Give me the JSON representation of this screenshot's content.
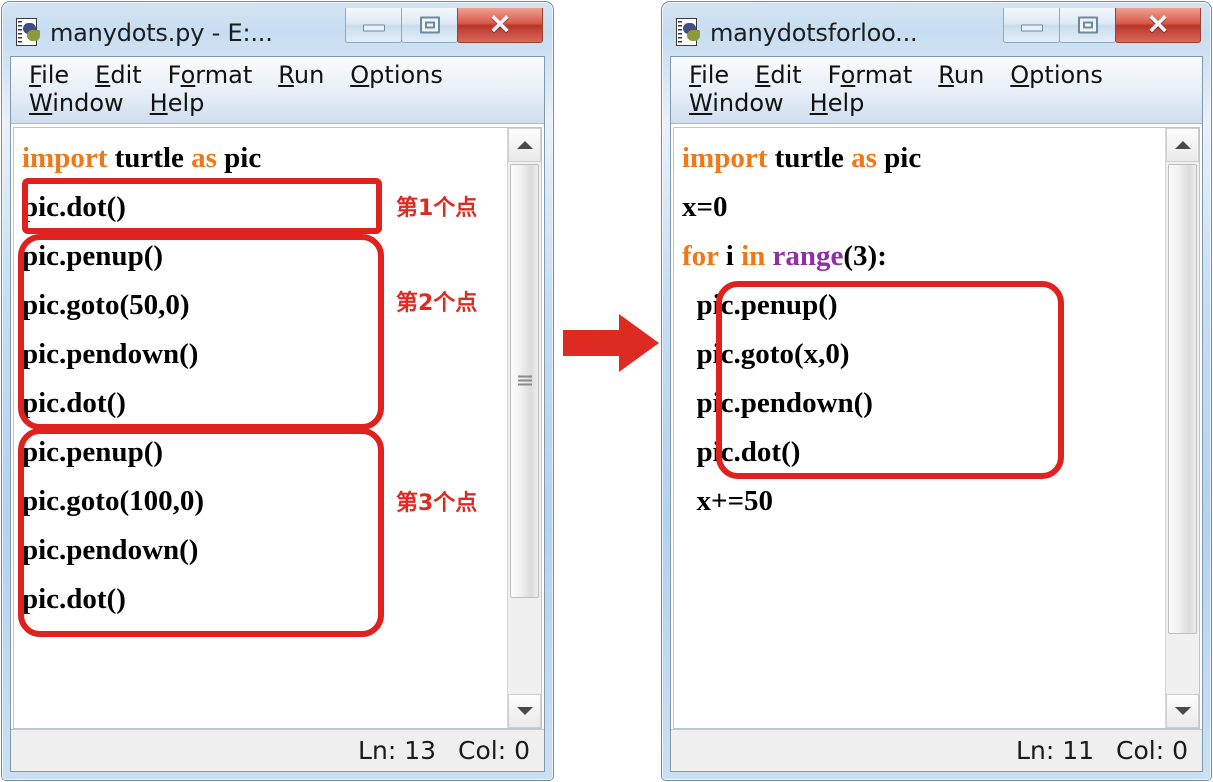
{
  "windows": [
    {
      "id": "left",
      "title": "manydots.py - E:...",
      "icon": "python-file-icon",
      "caption_buttons": [
        {
          "name": "minimize-button",
          "label": ""
        },
        {
          "name": "maximize-button",
          "label": ""
        },
        {
          "name": "close-button",
          "label": "✕"
        }
      ],
      "menus_row1": [
        {
          "name": "menu-file",
          "pre": "",
          "mn": "F",
          "post": "ile"
        },
        {
          "name": "menu-edit",
          "pre": "",
          "mn": "E",
          "post": "dit"
        },
        {
          "name": "menu-format",
          "pre": "F",
          "mn": "o",
          "post": "rmat"
        },
        {
          "name": "menu-run",
          "pre": "",
          "mn": "R",
          "post": "un"
        },
        {
          "name": "menu-options",
          "pre": "",
          "mn": "O",
          "post": "ptions"
        }
      ],
      "menus_row2": [
        {
          "name": "menu-window",
          "pre": "",
          "mn": "W",
          "post": "indow"
        },
        {
          "name": "menu-help",
          "pre": "",
          "mn": "H",
          "post": "elp"
        }
      ],
      "code_lines": [
        [
          {
            "t": "import",
            "c": "kw"
          },
          {
            "t": " turtle ",
            "c": ""
          },
          {
            "t": "as",
            "c": "kw"
          },
          {
            "t": " pic",
            "c": ""
          }
        ],
        [
          {
            "t": "pic.dot()",
            "c": ""
          }
        ],
        [
          {
            "t": "pic.penup()",
            "c": ""
          }
        ],
        [
          {
            "t": "pic.goto(50,0)",
            "c": ""
          }
        ],
        [
          {
            "t": "pic.pendown()",
            "c": ""
          }
        ],
        [
          {
            "t": "pic.dot()",
            "c": ""
          }
        ],
        [
          {
            "t": "pic.penup()",
            "c": ""
          }
        ],
        [
          {
            "t": "pic.goto(100,0)",
            "c": ""
          }
        ],
        [
          {
            "t": "pic.pendown()",
            "c": ""
          }
        ],
        [
          {
            "t": "pic.dot()",
            "c": ""
          }
        ]
      ],
      "annotations": [
        {
          "name": "annotation-label-point-1",
          "text": "第1个点"
        },
        {
          "name": "annotation-label-point-2",
          "text": "第2个点"
        },
        {
          "name": "annotation-label-point-3",
          "text": "第3个点"
        }
      ],
      "status": {
        "line": "Ln: 13",
        "col": "Col: 0"
      }
    },
    {
      "id": "right",
      "title": "manydotsforloo...",
      "icon": "python-file-icon",
      "caption_buttons": [
        {
          "name": "minimize-button",
          "label": ""
        },
        {
          "name": "maximize-button",
          "label": ""
        },
        {
          "name": "close-button",
          "label": "✕"
        }
      ],
      "menus_row1": [
        {
          "name": "menu-file",
          "pre": "",
          "mn": "F",
          "post": "ile"
        },
        {
          "name": "menu-edit",
          "pre": "",
          "mn": "E",
          "post": "dit"
        },
        {
          "name": "menu-format",
          "pre": "F",
          "mn": "o",
          "post": "rmat"
        },
        {
          "name": "menu-run",
          "pre": "",
          "mn": "R",
          "post": "un"
        },
        {
          "name": "menu-options",
          "pre": "",
          "mn": "O",
          "post": "ptions"
        }
      ],
      "menus_row2": [
        {
          "name": "menu-window",
          "pre": "",
          "mn": "W",
          "post": "indow"
        },
        {
          "name": "menu-help",
          "pre": "",
          "mn": "H",
          "post": "elp"
        }
      ],
      "code_lines": [
        [
          {
            "t": "import",
            "c": "kw"
          },
          {
            "t": " turtle ",
            "c": ""
          },
          {
            "t": "as",
            "c": "kw"
          },
          {
            "t": " pic",
            "c": ""
          }
        ],
        [
          {
            "t": "x=0",
            "c": ""
          }
        ],
        [
          {
            "t": "for",
            "c": "kw"
          },
          {
            "t": " i ",
            "c": ""
          },
          {
            "t": "in",
            "c": "kw"
          },
          {
            "t": " ",
            "c": ""
          },
          {
            "t": "range",
            "c": "bi"
          },
          {
            "t": "(3):",
            "c": ""
          }
        ],
        [
          {
            "t": "  pic.penup()",
            "c": ""
          }
        ],
        [
          {
            "t": "  pic.goto(x,0)",
            "c": ""
          }
        ],
        [
          {
            "t": "  pic.pendown()",
            "c": ""
          }
        ],
        [
          {
            "t": "  pic.dot()",
            "c": ""
          }
        ],
        [
          {
            "t": "  x+=50",
            "c": ""
          }
        ]
      ],
      "annotations": [],
      "status": {
        "line": "Ln: 11",
        "col": "Col: 0"
      }
    }
  ],
  "arrow": {
    "name": "flow-arrow-right",
    "color": "#dd2b22"
  },
  "colors": {
    "keyword": "#f07818",
    "builtin": "#8f2fa8",
    "annotation": "#dd2b22",
    "titlebar": "#c4dbf0"
  }
}
